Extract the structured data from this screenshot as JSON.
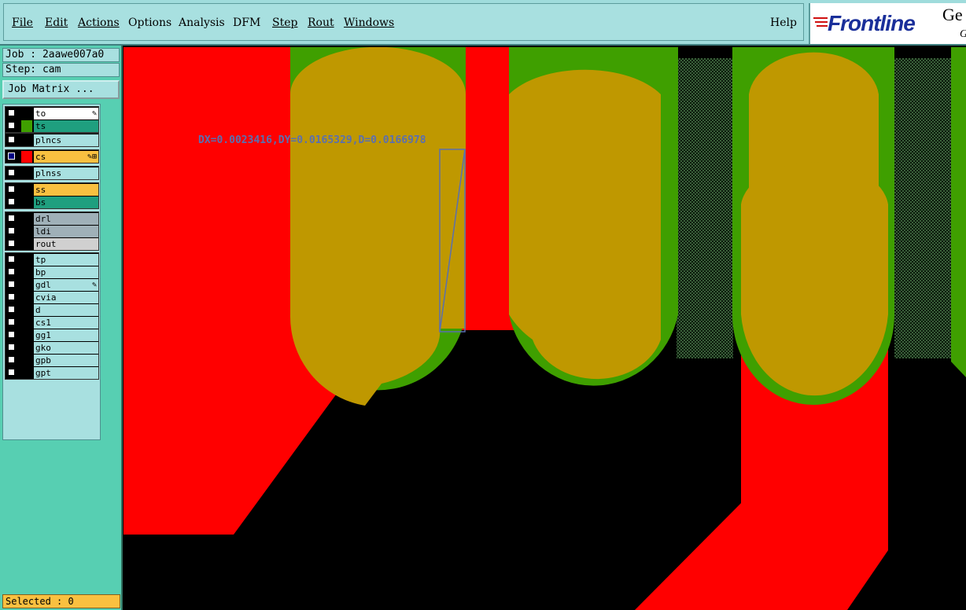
{
  "menubar": {
    "items": [
      {
        "label": "File"
      },
      {
        "label": "Edit"
      },
      {
        "label": "Actions"
      },
      {
        "label": "Options"
      },
      {
        "label": "Analysis"
      },
      {
        "label": "DFM"
      },
      {
        "label": "Step"
      },
      {
        "label": "Rout"
      },
      {
        "label": "Windows"
      }
    ],
    "help": "Help"
  },
  "logo": {
    "brand": "Frontline",
    "suffix": "Ge",
    "suffix2": "G"
  },
  "job": {
    "job_line": "Job : 2aawe007a0",
    "step_line": "Step: cam",
    "matrix_button": "Job Matrix ..."
  },
  "layers": [
    {
      "name": "to",
      "color": "#000000",
      "name_bg": "#ffffff",
      "flag": "✎",
      "active": false
    },
    {
      "name": "ts",
      "color": "#3f9f00",
      "name_bg": "#1f9f7f",
      "flag": "",
      "active": false
    },
    {
      "name": "plncs",
      "color": "#000000",
      "name_bg": "#a8e0e0",
      "flag": "",
      "active": false
    },
    {
      "name": "cs",
      "color": "#ff0000",
      "name_bg": "#f9c040",
      "flag": "✎⊞",
      "active": true
    },
    {
      "name": "plnss",
      "color": "#000000",
      "name_bg": "#a8e0e0",
      "flag": "",
      "active": false
    },
    {
      "name": "ss",
      "color": "#000000",
      "name_bg": "#f9c040",
      "flag": "",
      "active": false
    },
    {
      "name": "bs",
      "color": "#000000",
      "name_bg": "#1f9f7f",
      "flag": "",
      "active": false
    },
    {
      "name": "drl",
      "color": "#000000",
      "name_bg": "#9fb0b8",
      "flag": "",
      "active": false
    },
    {
      "name": "ldi",
      "color": "#000000",
      "name_bg": "#9fb0b8",
      "flag": "",
      "active": false
    },
    {
      "name": "rout",
      "color": "#000000",
      "name_bg": "#d0d0d0",
      "flag": "",
      "active": false
    },
    {
      "name": "tp",
      "color": "#000000",
      "name_bg": "#a8e0e0",
      "flag": "",
      "active": false
    },
    {
      "name": "bp",
      "color": "#000000",
      "name_bg": "#a8e0e0",
      "flag": "",
      "active": false
    },
    {
      "name": "gdl",
      "color": "#000000",
      "name_bg": "#a8e0e0",
      "flag": "✎",
      "active": false
    },
    {
      "name": "cvia",
      "color": "#000000",
      "name_bg": "#a8e0e0",
      "flag": "",
      "active": false
    },
    {
      "name": "d",
      "color": "#000000",
      "name_bg": "#a8e0e0",
      "flag": "",
      "active": false
    },
    {
      "name": "cs1",
      "color": "#000000",
      "name_bg": "#a8e0e0",
      "flag": "",
      "active": false
    },
    {
      "name": "gg1",
      "color": "#000000",
      "name_bg": "#a8e0e0",
      "flag": "",
      "active": false
    },
    {
      "name": "gko",
      "color": "#000000",
      "name_bg": "#a8e0e0",
      "flag": "",
      "active": false
    },
    {
      "name": "gpb",
      "color": "#000000",
      "name_bg": "#a8e0e0",
      "flag": "",
      "active": false
    },
    {
      "name": "gpt",
      "color": "#000000",
      "name_bg": "#a8e0e0",
      "flag": "",
      "active": false
    }
  ],
  "status": {
    "selected": "Selected : 0"
  },
  "measurement": {
    "label": "DX=0.0023416,DY=0.0165329,D=0.0166978"
  },
  "colors": {
    "copper": "#ff0000",
    "mask": "#3f9f00",
    "overlap": "#bf9800",
    "hatch": "#2f4f2f",
    "measure": "#5a6fb0"
  }
}
